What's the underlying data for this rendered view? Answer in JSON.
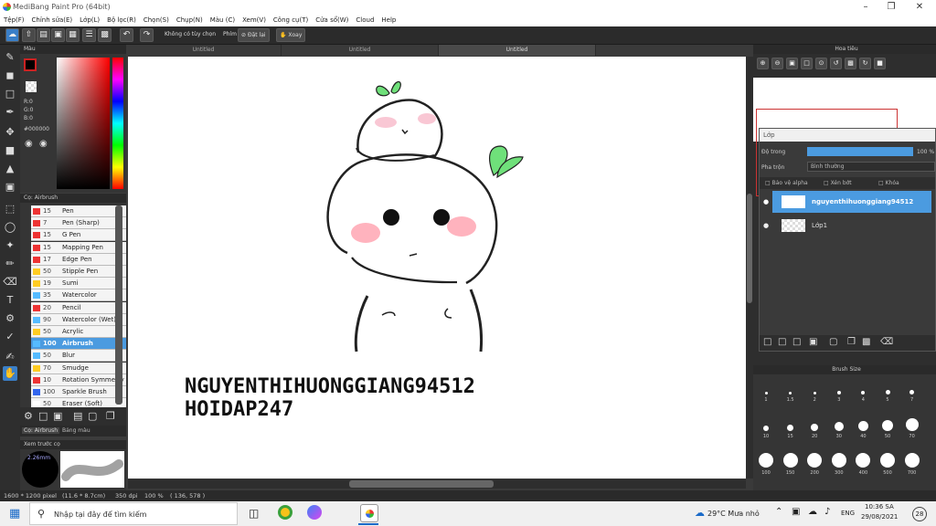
{
  "window": {
    "title": "MediBang Paint Pro (64bit)"
  },
  "menu": [
    "Tệp(F)",
    "Chỉnh sửa(E)",
    "Lớp(L)",
    "Bộ lọc(R)",
    "Chọn(S)",
    "Chụp(N)",
    "Màu (C)",
    "Xem(V)",
    "Công cụ(T)",
    "Cửa sổ(W)",
    "Cloud",
    "Help"
  ],
  "toolbar": {
    "option_label": "Không có tùy chọn",
    "key_label": "Phím",
    "reset_label": "Đặt lại",
    "rotate_label": "Xoay"
  },
  "color_panel": {
    "title": "Màu",
    "r": "R:0",
    "g": "G:0",
    "b": "B:0",
    "hex": "#000000",
    "fg_color": "#000000"
  },
  "brush_panel": {
    "title": "Cọ: Airbrush",
    "items": [
      {
        "size": "15",
        "name": "Pen",
        "color": "#e33"
      },
      {
        "size": "7",
        "name": "Pen (Sharp)",
        "color": "#e33"
      },
      {
        "size": "15",
        "name": "G Pen",
        "color": "#e33"
      },
      {
        "size": "15",
        "name": "Mapping Pen",
        "color": "#e33"
      },
      {
        "size": "17",
        "name": "Edge Pen",
        "color": "#e33"
      },
      {
        "size": "50",
        "name": "Stipple Pen",
        "color": "#fc2"
      },
      {
        "size": "19",
        "name": "Sumi",
        "color": "#fc2"
      },
      {
        "size": "35",
        "name": "Watercolor",
        "color": "#5bf"
      },
      {
        "size": "20",
        "name": "Pencil",
        "color": "#e33"
      },
      {
        "size": "90",
        "name": "Watercolor (Wet)",
        "color": "#5bf"
      },
      {
        "size": "50",
        "name": "Acrylic",
        "color": "#fc2"
      },
      {
        "size": "100",
        "name": "Airbrush",
        "color": "#5bf"
      },
      {
        "size": "50",
        "name": "Blur",
        "color": "#5bf"
      },
      {
        "size": "70",
        "name": "Smudge",
        "color": "#fc2"
      },
      {
        "size": "10",
        "name": "Rotation Symmetry",
        "color": "#e33"
      },
      {
        "size": "100",
        "name": "Sparkle Brush",
        "color": "#36e"
      },
      {
        "size": "50",
        "name": "Eraser (Soft)",
        "color": "#fff"
      }
    ],
    "tab_brush": "Cọ: Airbrush",
    "tab_color": "Bảng màu"
  },
  "preview_panel": {
    "title": "Xem trước cọ",
    "size": "2.26mm"
  },
  "doc_tabs": [
    "Untitled",
    "Untitled",
    "Untitled"
  ],
  "canvas_text": {
    "line1": "NGUYENTHIHUONGGIANG94512",
    "line2": "HOIDAP247"
  },
  "navigator": {
    "title": "Hoa tiêu"
  },
  "layer_panel": {
    "title": "Lớp",
    "opacity_label": "Độ trong",
    "opacity_value": "100 %",
    "blend_label": "Pha trộn",
    "blend_value": "Bình thường",
    "protect_alpha": "Bảo vệ alpha",
    "clipping": "Xén bớt",
    "lock": "Khóa",
    "layers": [
      {
        "name": "nguyenthihuonggiang94512",
        "selected": true
      },
      {
        "name": "Lớp1",
        "selected": false
      }
    ]
  },
  "brush_size_panel": {
    "title": "Brush Size",
    "sizes": [
      "1",
      "1.5",
      "2",
      "3",
      "4",
      "5",
      "7",
      "10",
      "15",
      "20",
      "30",
      "40",
      "50",
      "70",
      "100",
      "150",
      "200",
      "300",
      "400",
      "500",
      "700"
    ]
  },
  "status": {
    "dimensions": "1600 * 1200 pixel",
    "physical": "(11.6 * 8.7cm)",
    "dpi": "350 dpi",
    "zoom": "100 %",
    "coords": "( 136, 578 )"
  },
  "taskbar": {
    "search_placeholder": "Nhập tại đây để tìm kiếm",
    "weather": "29°C Mưa nhỏ",
    "lang": "ENG",
    "time": "10:36 SA",
    "date": "29/08/2021",
    "notif_count": "28"
  }
}
